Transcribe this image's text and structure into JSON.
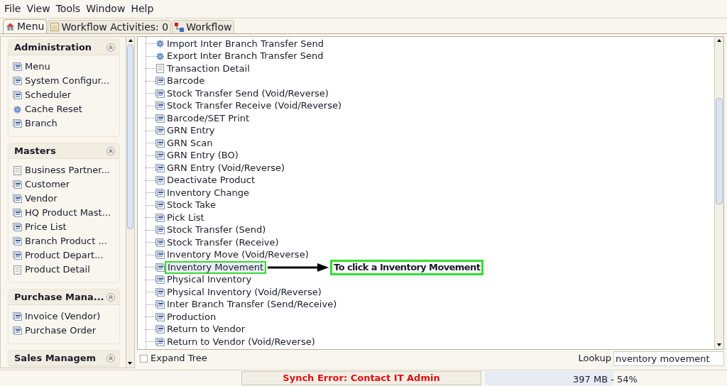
{
  "menu_bar": [
    {
      "label": "File"
    },
    {
      "label": "View"
    },
    {
      "label": "Tools"
    },
    {
      "label": "Window"
    },
    {
      "label": "Help"
    }
  ],
  "tabs": [
    {
      "label": "Menu",
      "selected": true
    },
    {
      "label": "Workflow Activities: 0",
      "selected": false
    },
    {
      "label": "Workflow",
      "selected": false
    }
  ],
  "sidebar": {
    "sections": [
      {
        "title": "Administration",
        "items": [
          {
            "kind": "window",
            "label": "Menu"
          },
          {
            "kind": "window",
            "label": "System Configur..."
          },
          {
            "kind": "window",
            "label": "Scheduler"
          },
          {
            "kind": "process",
            "label": "Cache Reset"
          },
          {
            "kind": "window",
            "label": "Branch"
          }
        ]
      },
      {
        "title": "Masters",
        "items": [
          {
            "kind": "report",
            "label": "Business Partner..."
          },
          {
            "kind": "window",
            "label": "Customer"
          },
          {
            "kind": "window",
            "label": "Vendor"
          },
          {
            "kind": "window",
            "label": "HQ Product Mast..."
          },
          {
            "kind": "window",
            "label": "Price List"
          },
          {
            "kind": "window",
            "label": "Branch Product ..."
          },
          {
            "kind": "window",
            "label": "Product Depart..."
          },
          {
            "kind": "report",
            "label": "Product Detail"
          }
        ]
      },
      {
        "title": "Purchase Mana...",
        "items": [
          {
            "kind": "window",
            "label": "Invoice (Vendor)"
          },
          {
            "kind": "window",
            "label": "Purchase Order"
          }
        ]
      },
      {
        "title": "Sales Managem"
      }
    ]
  },
  "tree": {
    "items": [
      {
        "kind": "process",
        "label": "Import Inter Branch Transfer Send",
        "selected": false
      },
      {
        "kind": "process",
        "label": "Export Inter Branch Transfer Send",
        "selected": false
      },
      {
        "kind": "report",
        "label": "Transaction Detail",
        "selected": false
      },
      {
        "kind": "window",
        "label": "Barcode",
        "selected": false
      },
      {
        "kind": "window",
        "label": "Stock Transfer Send (Void/Reverse)",
        "selected": false
      },
      {
        "kind": "window",
        "label": "Stock Transfer Receive (Void/Reverse)",
        "selected": false
      },
      {
        "kind": "window",
        "label": "Barcode/SET Print",
        "selected": false
      },
      {
        "kind": "window",
        "label": "GRN Entry",
        "selected": false
      },
      {
        "kind": "window",
        "label": "GRN Scan",
        "selected": false
      },
      {
        "kind": "window",
        "label": "GRN Entry (BO)",
        "selected": false
      },
      {
        "kind": "window",
        "label": "GRN Entry (Void/Reverse)",
        "selected": false
      },
      {
        "kind": "window",
        "label": "Deactivate Product",
        "selected": false
      },
      {
        "kind": "window",
        "label": "Inventory Change",
        "selected": false
      },
      {
        "kind": "window",
        "label": "Stock Take",
        "selected": false
      },
      {
        "kind": "window",
        "label": "Pick List",
        "selected": false
      },
      {
        "kind": "window",
        "label": "Stock Transfer (Send)",
        "selected": false
      },
      {
        "kind": "window",
        "label": "Stock Transfer (Receive)",
        "selected": false
      },
      {
        "kind": "window",
        "label": "Inventory Move (Void/Reverse)",
        "selected": false
      },
      {
        "kind": "window",
        "label": "Inventory Movement",
        "selected": true,
        "callout": "To click a Inventory Movement"
      },
      {
        "kind": "window",
        "label": "Physical Inventory",
        "selected": false
      },
      {
        "kind": "window",
        "label": "Physical Inventory (Void/Reverse)",
        "selected": false
      },
      {
        "kind": "window",
        "label": "Inter Branch Transfer (Send/Receive)",
        "selected": false
      },
      {
        "kind": "window",
        "label": "Production",
        "selected": false
      },
      {
        "kind": "window",
        "label": "Return to Vendor",
        "selected": false
      },
      {
        "kind": "window",
        "label": "Return to Vendor (Void/Reverse)",
        "selected": false
      }
    ]
  },
  "expand_tree": {
    "label": "Expand Tree",
    "checked": false
  },
  "lookup": {
    "label": "Lookup",
    "value": "nventory movement"
  },
  "status_bar": {
    "message": "Synch Error: Contact IT Admin",
    "memory": {
      "reading": "397 MB - 54%",
      "level": 0.54
    }
  }
}
